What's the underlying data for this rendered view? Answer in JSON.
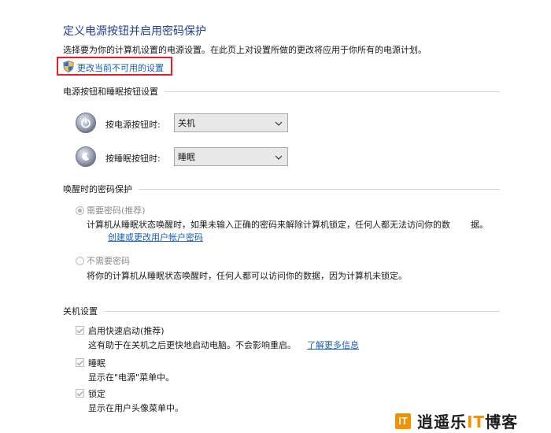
{
  "header": {
    "title": "定义电源按钮并启用密码保护",
    "description": "选择要为你的计算机设置的电源设置。在此页上对设置所做的更改将应用于你所有的电源计划。",
    "admin_link": "更改当前不可用的设置"
  },
  "power_buttons": {
    "section_title": "电源按钮和睡眠按钮设置",
    "power_label": "按电源按钮时:",
    "power_value": "关机",
    "sleep_label": "按睡眠按钮时:",
    "sleep_value": "睡眠"
  },
  "password": {
    "section_title": "唤醒时的密码保护",
    "require_label": "需要密码(推荐)",
    "require_desc": "计算机从睡眠状态唤醒时，如果未输入正确的密码来解除计算机锁定，任何人都无法访问你的数",
    "require_desc2": "据。",
    "create_link": "创建或更改用户帐户密码",
    "no_require_label": "不需要密码",
    "no_require_desc": "将你的计算机从睡眠状态唤醒时，任何人都可以访问你的数据，因为计算机未锁定。",
    "selected": "require"
  },
  "shutdown": {
    "section_title": "关机设置",
    "fast_label": "启用快速启动(推荐)",
    "fast_desc": "这有助于在关机之后更快地启动电脑。不会影响重启。",
    "learn_more": "了解更多信息",
    "sleep_label": "睡眠",
    "sleep_desc": "显示在\"电源\"菜单中。",
    "lock_label": "锁定",
    "lock_desc": "显示在用户头像菜单中。"
  },
  "watermark": {
    "logo": "IT",
    "text_a": "逍遥乐",
    "text_b": "IT",
    "text_c": "博客"
  },
  "colors": {
    "title": "#1e3f9a",
    "link": "#1a5fb4",
    "highlight_box": "#e31e24",
    "watermark_accent": "#f39200"
  }
}
